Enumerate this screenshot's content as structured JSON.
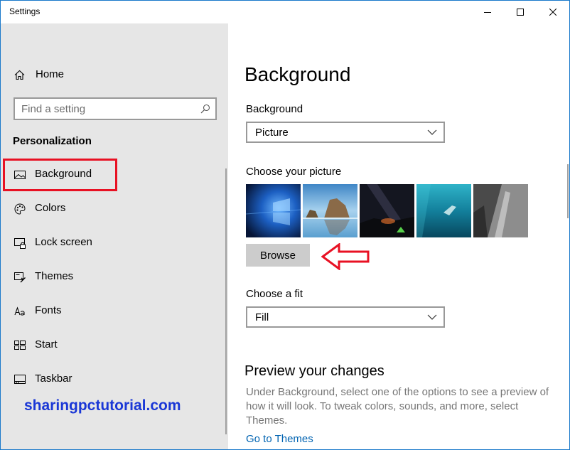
{
  "window": {
    "title": "Settings"
  },
  "sidebar": {
    "home_label": "Home",
    "search_placeholder": "Find a setting",
    "section_title": "Personalization",
    "items": [
      {
        "label": "Background",
        "icon": "picture-icon",
        "selected": true
      },
      {
        "label": "Colors",
        "icon": "palette-icon"
      },
      {
        "label": "Lock screen",
        "icon": "lock-screen-icon"
      },
      {
        "label": "Themes",
        "icon": "brush-icon"
      },
      {
        "label": "Fonts",
        "icon": "fonts-icon"
      },
      {
        "label": "Start",
        "icon": "start-icon"
      },
      {
        "label": "Taskbar",
        "icon": "taskbar-icon"
      }
    ]
  },
  "main": {
    "title": "Background",
    "background_label": "Background",
    "background_value": "Picture",
    "choose_picture_label": "Choose your picture",
    "browse_label": "Browse",
    "choose_fit_label": "Choose a fit",
    "fit_value": "Fill",
    "preview_title": "Preview your changes",
    "preview_text": "Under Background, select one of the options to see a preview of how it will look. To tweak colors, sounds, and more, select Themes.",
    "themes_link": "Go to Themes"
  },
  "watermark": "sharingpctutorial.com",
  "colors": {
    "highlight": "#e81123",
    "accent_link": "#0063b1",
    "watermark": "#1a37d6",
    "sidebar_bg": "#e6e6e6"
  }
}
